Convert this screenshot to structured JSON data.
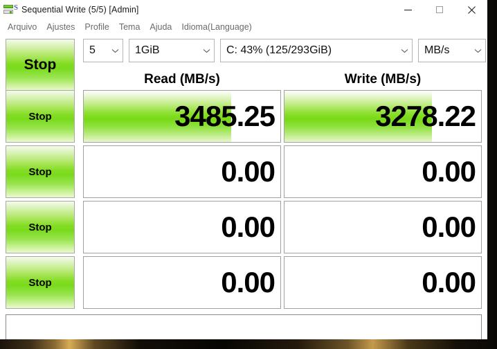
{
  "window": {
    "title": "Sequential Write (5/5) [Admin]",
    "icon": "crystaldiskmark-icon",
    "controls": {
      "minimize": "minimize-icon",
      "maximize": "maximize-icon",
      "close": "close-icon"
    }
  },
  "menubar": {
    "items": [
      {
        "label": "Arquivo"
      },
      {
        "label": "Ajustes"
      },
      {
        "label": "Profile"
      },
      {
        "label": "Tema"
      },
      {
        "label": "Ajuda"
      },
      {
        "label": "Idioma(Language)"
      }
    ]
  },
  "toolbar": {
    "all_button_label": "Stop",
    "combos": {
      "count": {
        "value": "5"
      },
      "size": {
        "value": "1GiB"
      },
      "drive": {
        "value": "C: 43% (125/293GiB)"
      },
      "unit": {
        "value": "MB/s"
      }
    }
  },
  "headers": {
    "read": "Read (MB/s)",
    "write": "Write (MB/s)"
  },
  "colors": {
    "green_button": "#7ada1c",
    "progress_fill": "#78d915",
    "orange_marker": "#ff6a00"
  },
  "rows": [
    {
      "button_label": "Stop",
      "running": true,
      "read": {
        "value": "3485.25",
        "fill_percent": 75
      },
      "write": {
        "value": "3278.22",
        "fill_percent": 75
      }
    },
    {
      "button_label": "Stop",
      "running": false,
      "read": {
        "value": "0.00",
        "fill_percent": 0
      },
      "write": {
        "value": "0.00",
        "fill_percent": 0
      }
    },
    {
      "button_label": "Stop",
      "running": false,
      "read": {
        "value": "0.00",
        "fill_percent": 0
      },
      "write": {
        "value": "0.00",
        "fill_percent": 0
      }
    },
    {
      "button_label": "Stop",
      "running": false,
      "read": {
        "value": "0.00",
        "fill_percent": 0
      },
      "write": {
        "value": "0.00",
        "fill_percent": 0
      }
    }
  ],
  "statusbar": {
    "text": ""
  }
}
